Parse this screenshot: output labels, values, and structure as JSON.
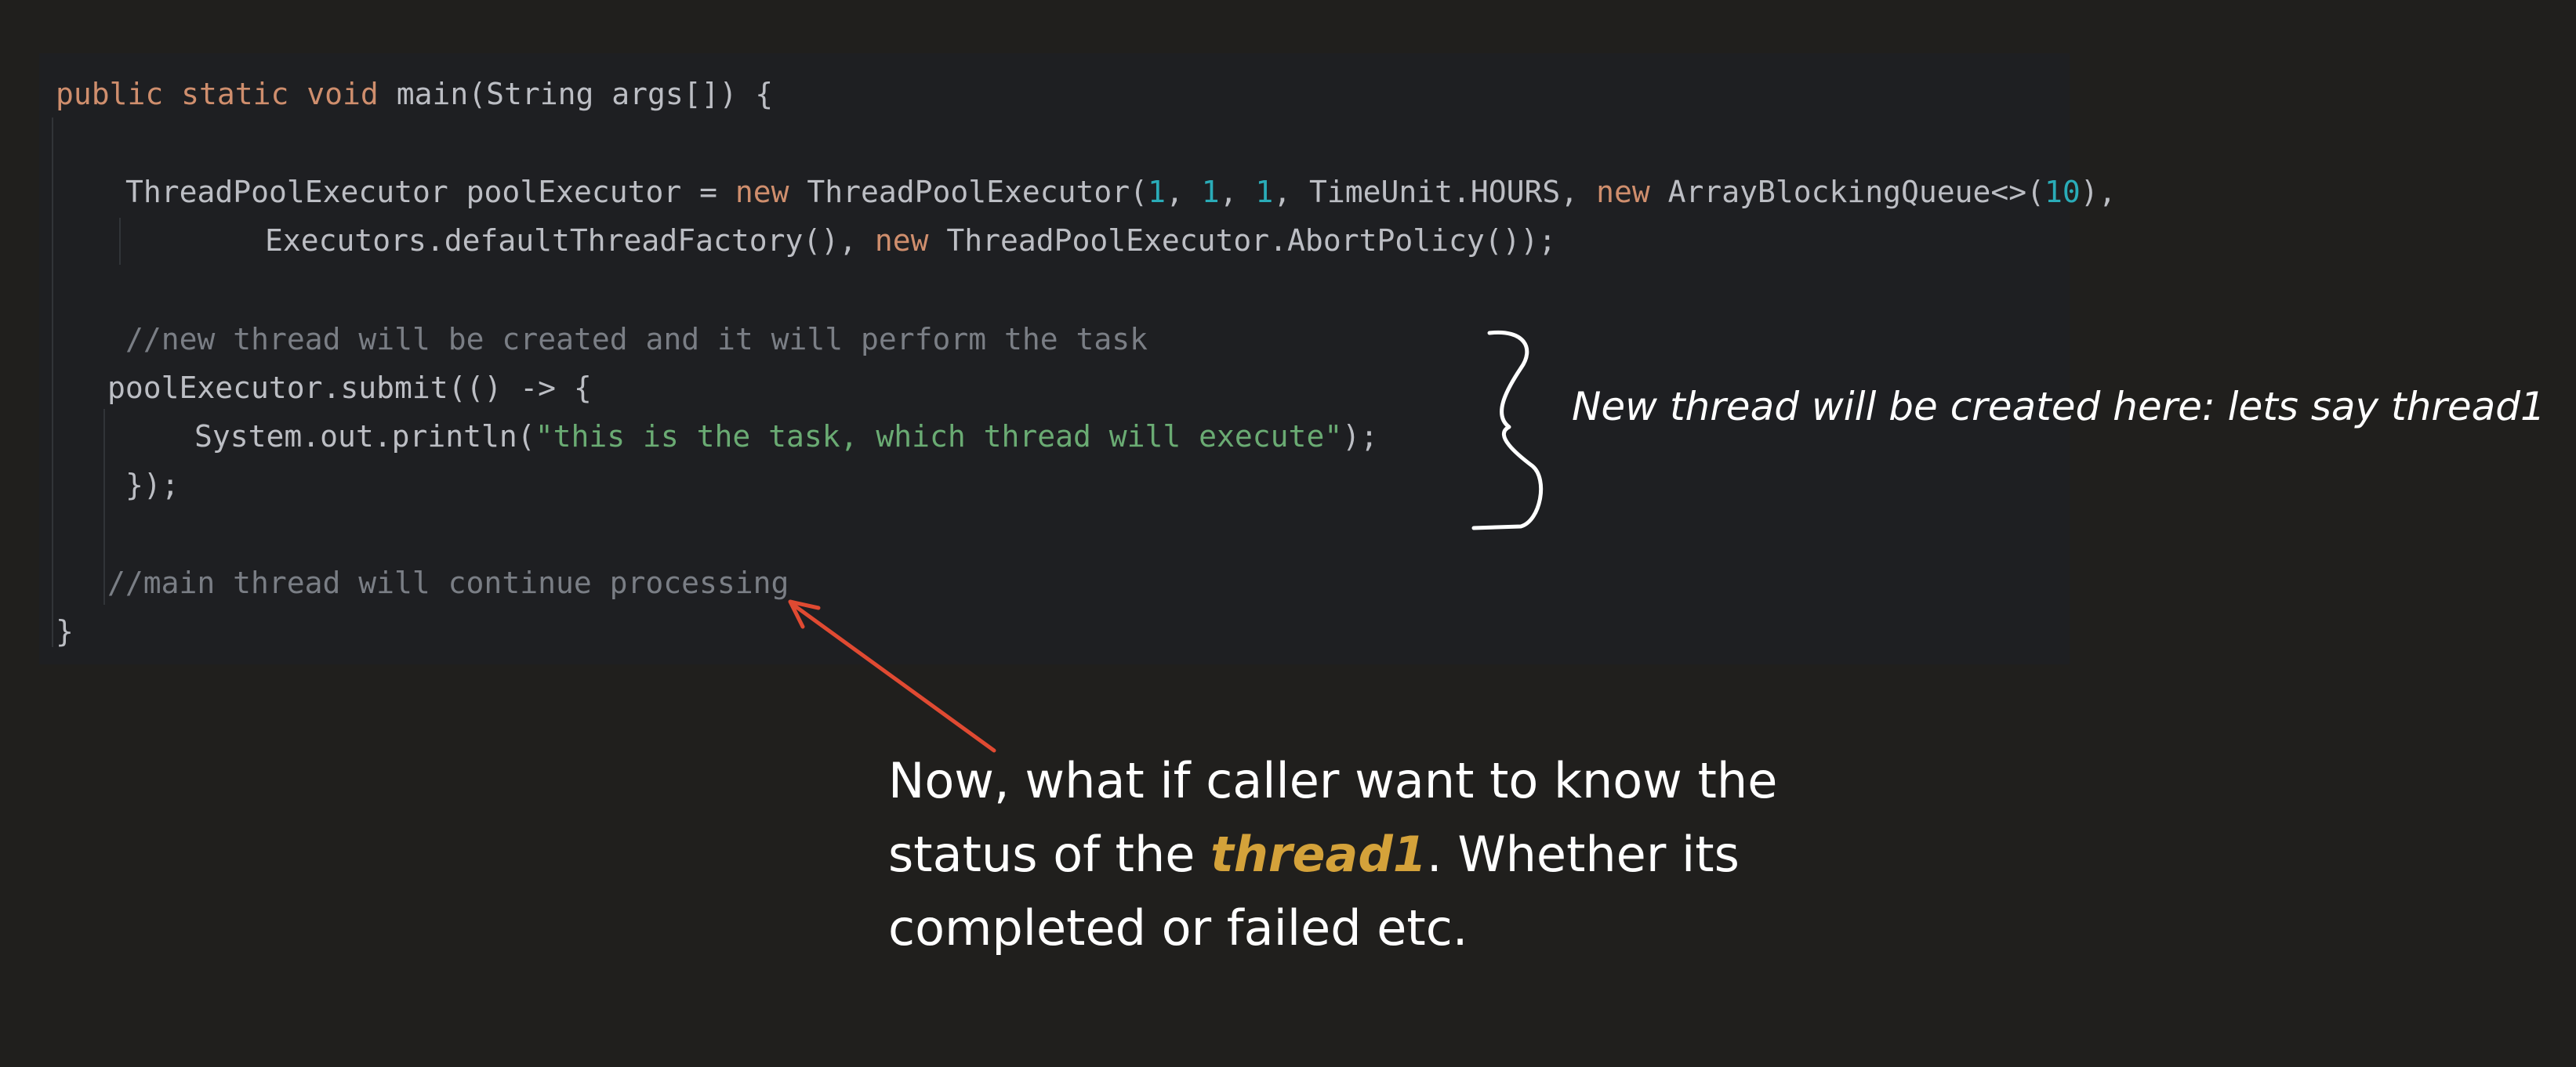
{
  "code": {
    "line1": {
      "kw": "public static void",
      "rest": " main(String args[]) {"
    },
    "line2": {
      "lead": "ThreadPoolExecutor poolExecutor = ",
      "new1": "new",
      "mid1": " ThreadPoolExecutor(",
      "n1": "1",
      "sep1": ", ",
      "n2": "1",
      "sep2": ", ",
      "n3": "1",
      "mid2": ", TimeUnit.HOURS, ",
      "new2": "new",
      "mid3": " ArrayBlockingQueue<>(",
      "n4": "10",
      "end": "),"
    },
    "line3": {
      "lead": "Executors.defaultThreadFactory(), ",
      "new": "new",
      "rest": " ThreadPoolExecutor.AbortPolicy());"
    },
    "comment1": "//new thread will be created and it will perform the task",
    "line5": "poolExecutor.submit(() -> {",
    "line6": {
      "lead": "System.out.println(",
      "str": "\"this is the task, which thread will execute\"",
      "end": ");"
    },
    "line7": "});",
    "comment2": "//main thread will continue processing",
    "line9": "}"
  },
  "annotations": {
    "side_note": "New thread will be created here: lets say thread1",
    "question": {
      "part1": "Now, what if caller want to know the status of the ",
      "highlight": "thread1",
      "part2": ". Whether its completed or failed etc."
    }
  },
  "colors": {
    "background": "#201f1d",
    "code_background": "#1e1f22",
    "keyword": "#cf8e6d",
    "number": "#2aacb8",
    "string": "#6aab73",
    "comment": "#7a7e85",
    "arrow": "#e04a32",
    "highlight": "#d4a23a"
  },
  "icons": {
    "brace": "curly-brace-icon",
    "arrow": "red-arrow-icon"
  }
}
